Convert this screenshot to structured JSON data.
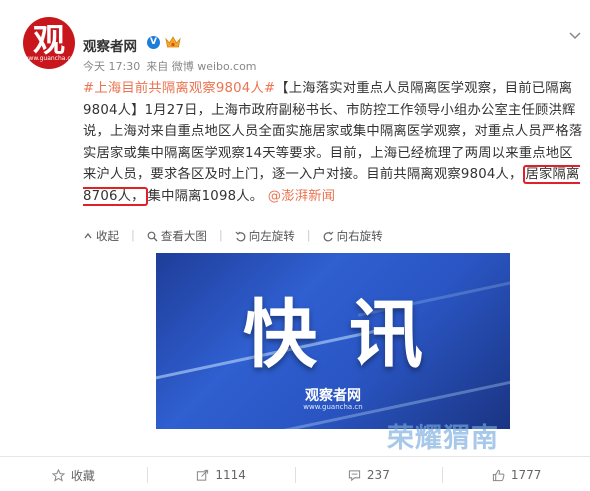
{
  "post": {
    "author": "观察者网",
    "avatar_glyph": "观",
    "avatar_site": "www.guancha.cn",
    "time": "今天 17:30",
    "source": "来自 微博 weibo.com",
    "hashtag": "#上海目前共隔离观察9804人#",
    "text_part1": "【上海落实对重点人员隔离医学观察，目前已隔离9804人】1月27日，上海市政府副秘书长、市防控工作领导小组办公室主任顾洪辉说，上海对来自重点地区人员全面实施居家或集中隔离医学观察，对重点人员严格落实居家或集中隔离医学观察14天等要求。目前，上海已经梳理了两周以来重点地区来沪人员，要求各区及时上门，逐一入户对接。目前共隔离观察9804人，",
    "highlight": "居家隔离8706人，",
    "text_part2": "集中隔离1098人。",
    "mention": "@澎湃新闻"
  },
  "image_toolbar": {
    "collapse": "收起",
    "view_large": "查看大图",
    "rotate_left": "向左旋转",
    "rotate_right": "向右旋转"
  },
  "image": {
    "headline": "快讯",
    "brand": "观察者网",
    "brand_url": "www.guancha.cn"
  },
  "watermark": "荣耀猬南",
  "actions": {
    "favorite": "收藏",
    "repost_count": "1114",
    "comment_count": "237",
    "like_count": "1777"
  },
  "colors": {
    "link": "#eb7350",
    "highlight_border": "#e1212a",
    "verified": "#1e7dd7",
    "avatar_bg": "#c9161d"
  }
}
